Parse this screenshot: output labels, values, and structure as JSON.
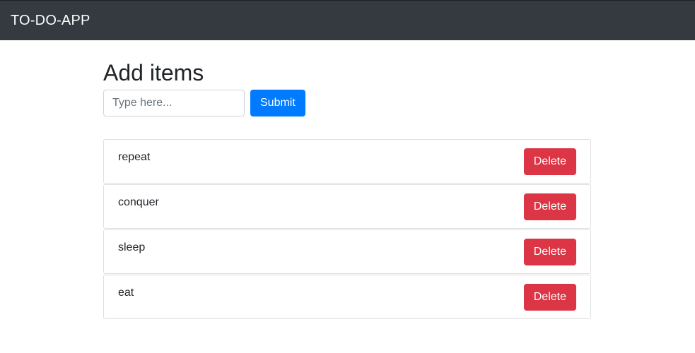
{
  "navbar": {
    "brand": "TO-DO-APP",
    "background_color": "#343a40"
  },
  "form": {
    "heading": "Add items",
    "input_placeholder": "Type here...",
    "input_value": "",
    "submit_label": "Submit",
    "submit_color": "#007bff"
  },
  "items": [
    {
      "text": "repeat",
      "delete_label": "Delete"
    },
    {
      "text": "conquer",
      "delete_label": "Delete"
    },
    {
      "text": "sleep",
      "delete_label": "Delete"
    },
    {
      "text": "eat",
      "delete_label": "Delete"
    }
  ],
  "colors": {
    "delete": "#dc3545"
  }
}
